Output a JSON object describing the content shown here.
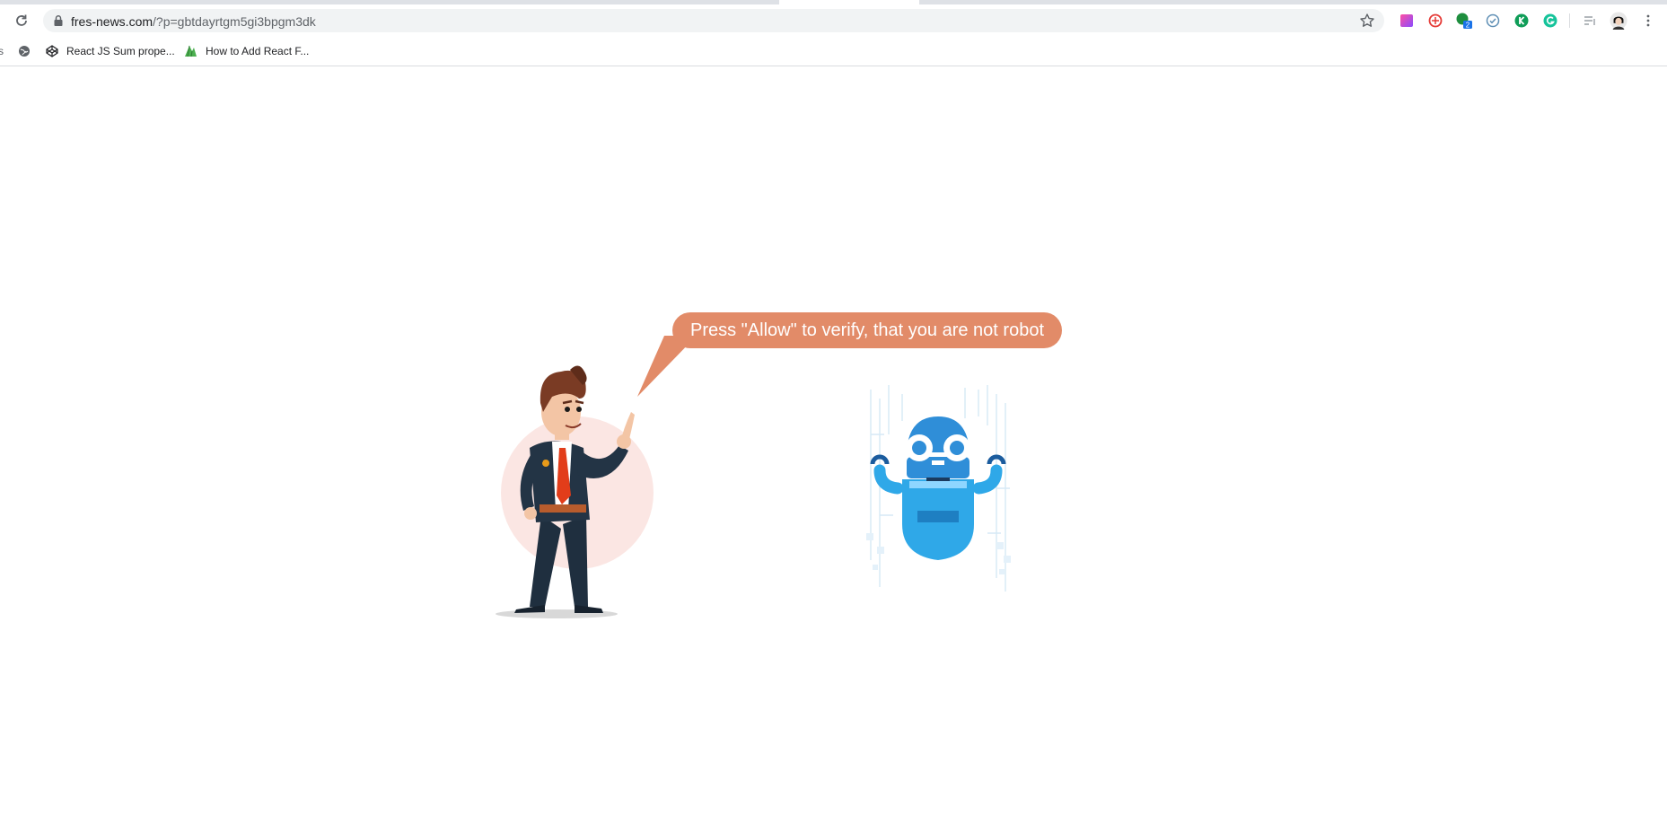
{
  "browser": {
    "url_host": "fres-news.com",
    "url_path": "/?p=gbtdayrtgm5gi3bpgm3dk",
    "bookmarks": [
      {
        "label": "React JS Sum prope...",
        "icon": "codepen-icon"
      },
      {
        "label": "How to Add React F...",
        "icon": "green-logo-icon"
      }
    ],
    "extensions": [
      "gradient-extension-icon",
      "red-target-extension-icon",
      "green-chat-extension-icon",
      "check-circle-extension-icon",
      "k-extension-icon",
      "grammarly-icon"
    ],
    "extension_badge": "2",
    "colors": {
      "accent": "#e28b68",
      "omnibox": "#f1f3f4",
      "robot": "#2fa8e8"
    }
  },
  "page": {
    "speech_bubble": "Press \"Allow\" to verify, that you are not robot"
  }
}
